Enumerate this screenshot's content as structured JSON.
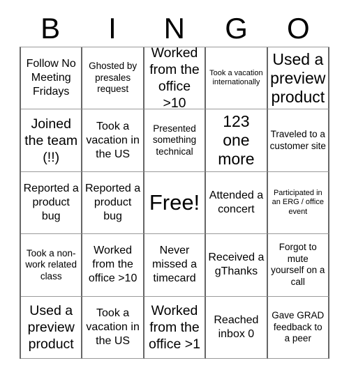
{
  "card": {
    "header_letters": [
      "B",
      "I",
      "N",
      "G",
      "O"
    ],
    "columns": 5,
    "rows": 5,
    "free_space": "Free!",
    "colors": {
      "text": "#000000",
      "background": "#ffffff",
      "vertical_gridline": "#666666",
      "horizontal_gridline": "#9a9a9a"
    },
    "cells": [
      [
        {
          "text": "Follow No Meeting Fridays",
          "size": "md"
        },
        {
          "text": "Ghosted by presales request",
          "size": "sm"
        },
        {
          "text": "Worked from the office >10",
          "size": "lg"
        },
        {
          "text": "Took a vacation internationally",
          "size": "xs"
        },
        {
          "text": "Used a preview product",
          "size": "xl"
        }
      ],
      [
        {
          "text": "Joined the team (!!)",
          "size": "lg"
        },
        {
          "text": "Took a vacation in the US",
          "size": "md"
        },
        {
          "text": "Presented something technical",
          "size": "sm"
        },
        {
          "text": "123 one more",
          "size": "xl"
        },
        {
          "text": "Traveled to a customer site",
          "size": "sm"
        }
      ],
      [
        {
          "text": "Reported a product bug",
          "size": "md"
        },
        {
          "text": "Reported a product bug",
          "size": "md"
        },
        {
          "text": "Free!",
          "size": "free"
        },
        {
          "text": "Attended a concert",
          "size": "md"
        },
        {
          "text": "Participated in an ERG / office event",
          "size": "xs"
        }
      ],
      [
        {
          "text": "Took a non-work related class",
          "size": "sm"
        },
        {
          "text": "Worked from the office >10",
          "size": "md"
        },
        {
          "text": "Never missed a timecard",
          "size": "md"
        },
        {
          "text": "Received a gThanks",
          "size": "md"
        },
        {
          "text": "Forgot to mute yourself on a call",
          "size": "sm"
        }
      ],
      [
        {
          "text": "Used a preview product",
          "size": "lg"
        },
        {
          "text": "Took a vacation in the US",
          "size": "md"
        },
        {
          "text": "Worked from the office >1",
          "size": "lg"
        },
        {
          "text": "Reached inbox 0",
          "size": "md"
        },
        {
          "text": "Gave GRAD feedback to a peer",
          "size": "sm"
        }
      ]
    ]
  }
}
